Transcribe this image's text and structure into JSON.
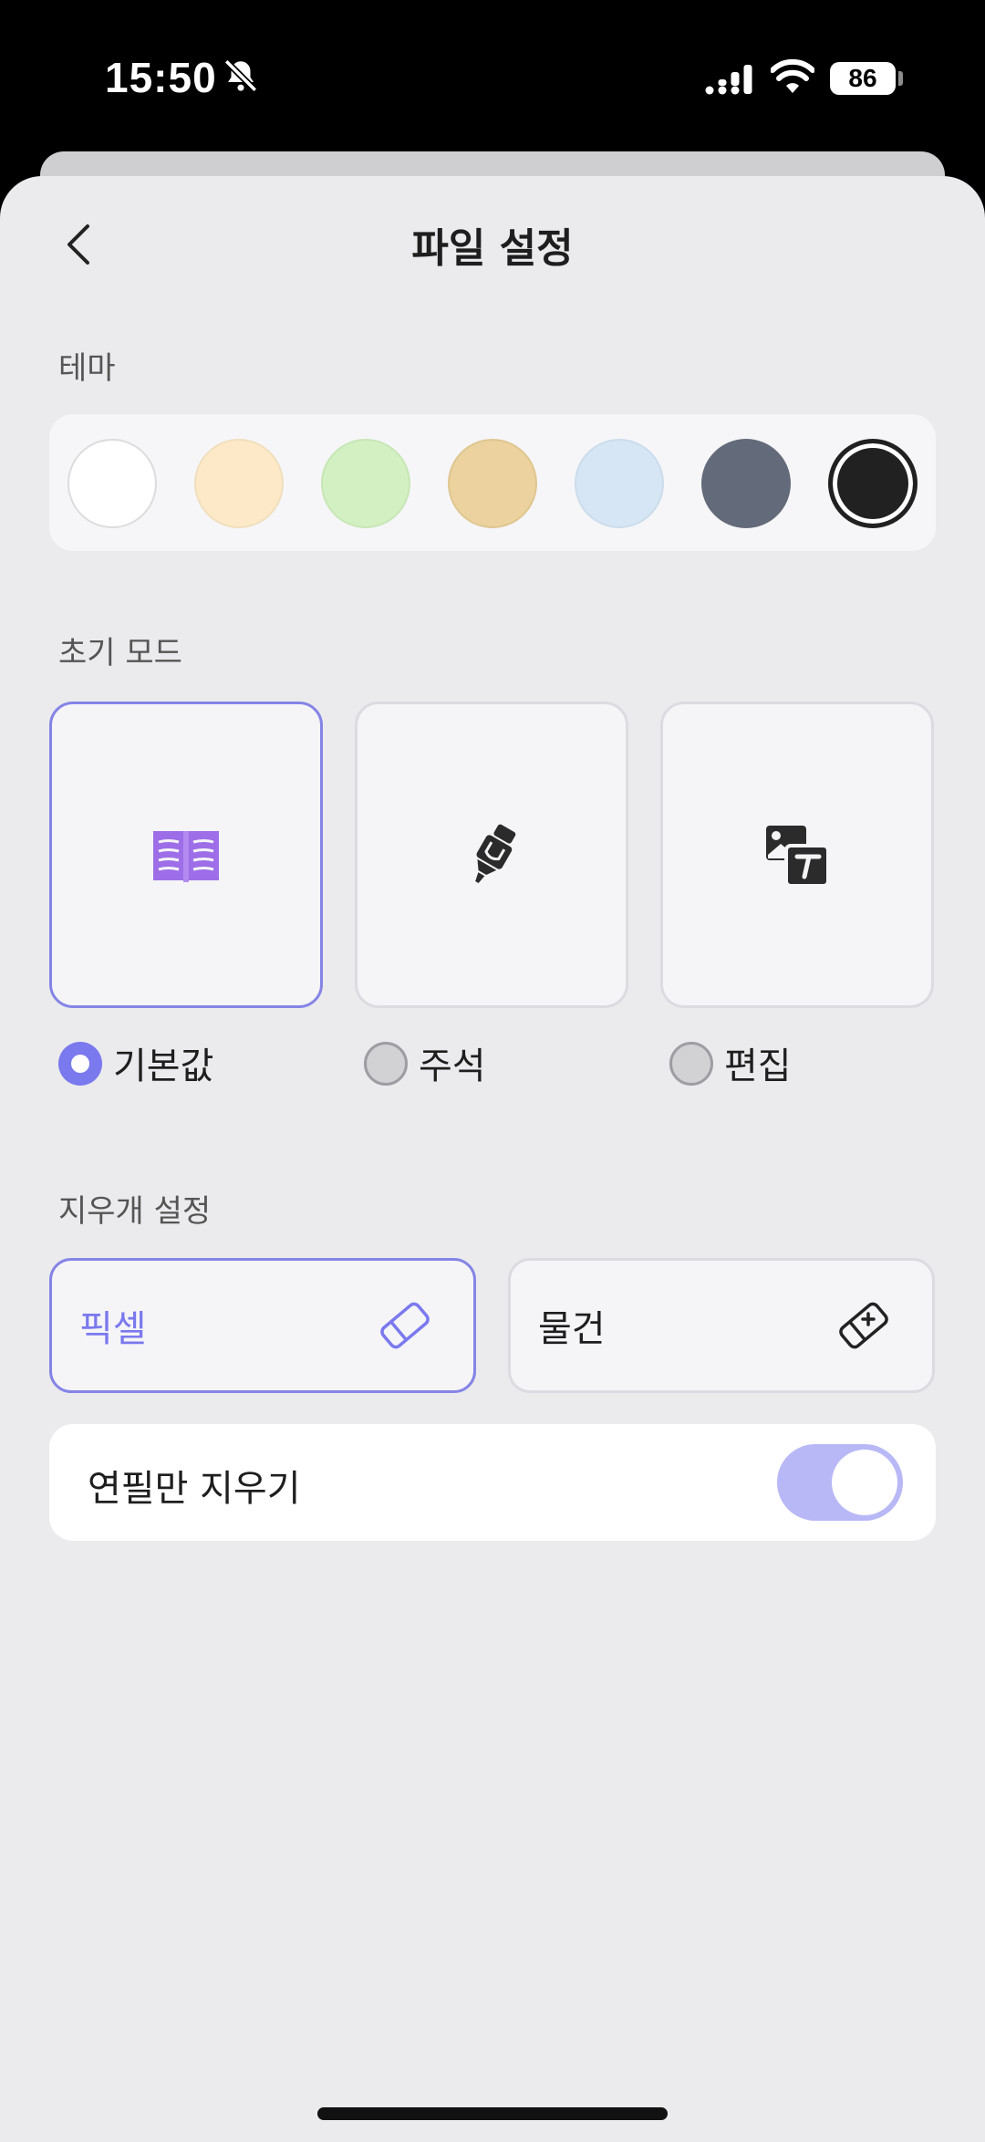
{
  "status_bar": {
    "time": "15:50",
    "battery": "86"
  },
  "header": {
    "title": "파일 설정"
  },
  "theme": {
    "label": "테마",
    "swatches": [
      {
        "name": "white",
        "color": "#ffffff"
      },
      {
        "name": "cream",
        "color": "#fde9c8"
      },
      {
        "name": "green",
        "color": "#d3f0c2"
      },
      {
        "name": "tan",
        "color": "#ebd29e"
      },
      {
        "name": "blue",
        "color": "#d6e6f5"
      },
      {
        "name": "slate",
        "color": "#636b7a"
      },
      {
        "name": "black",
        "color": "#212121",
        "selected": true
      }
    ]
  },
  "initial_mode": {
    "label": "초기 모드",
    "options": [
      {
        "label": "기본값",
        "icon": "book-icon",
        "selected": true
      },
      {
        "label": "주석",
        "icon": "highlighter-icon",
        "selected": false
      },
      {
        "label": "편집",
        "icon": "image-text-icon",
        "selected": false
      }
    ]
  },
  "eraser": {
    "label": "지우개 설정",
    "options": [
      {
        "label": "픽셀",
        "icon": "eraser-icon",
        "selected": true
      },
      {
        "label": "물건",
        "icon": "object-eraser-icon",
        "selected": false
      }
    ],
    "pencil_only": {
      "label": "연필만 지우기",
      "enabled": true
    }
  },
  "colors": {
    "accent": "#7a79ee",
    "toggle_on": "#b8b8f7"
  }
}
